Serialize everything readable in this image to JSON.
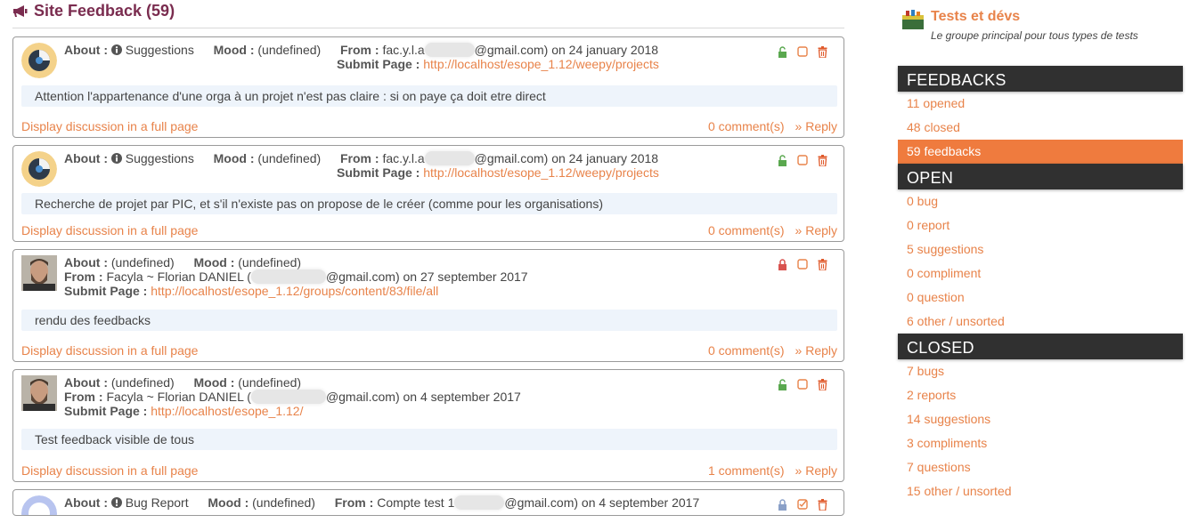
{
  "header": {
    "title": "Site Feedback (59)"
  },
  "labels": {
    "about": "About :",
    "mood": "Mood :",
    "from": "From :",
    "submit_page": "Submit Page :",
    "display_full": "Display discussion in a full page",
    "reply": "» Reply"
  },
  "feedbacks": [
    {
      "about": "Suggestions",
      "mood": "(undefined)",
      "from_prefix": "fac.y.l.a",
      "from_suffix": "@gmail.com) on 24 january 2018",
      "submit_page": "http://localhost/esope_1.12/weepy/projects",
      "message": "Attention l'appartenance d'une orga à un projet n'est pas claire : si on paye ça doit etre direct",
      "comments": "0 comment(s)"
    },
    {
      "about": "Suggestions",
      "mood": "(undefined)",
      "from_prefix": "fac.y.l.a",
      "from_suffix": "@gmail.com) on 24 january 2018",
      "submit_page": "http://localhost/esope_1.12/weepy/projects",
      "message": "Recherche de projet par PIC, et s'il n'existe pas on propose de le créer (comme pour les organisations)",
      "comments": "0 comment(s)"
    },
    {
      "about": "(undefined)",
      "mood": "(undefined)",
      "from_prefix": "Facyla ~ Florian DANIEL (",
      "from_suffix": "@gmail.com) on 27 september 2017",
      "submit_page": "http://localhost/esope_1.12/groups/content/83/file/all",
      "message": "rendu des feedbacks",
      "comments": "0 comment(s)"
    },
    {
      "about": "(undefined)",
      "mood": "(undefined)",
      "from_prefix": "Facyla ~ Florian DANIEL (",
      "from_suffix": "@gmail.com) on 4 september 2017",
      "submit_page": "http://localhost/esope_1.12/",
      "message": "Test feedback visible de tous",
      "comments": "1 comment(s)"
    },
    {
      "about": "Bug Report",
      "mood": "(undefined)",
      "from_prefix": "Compte test 1",
      "from_suffix": "@gmail.com) on 4 september 2017"
    }
  ],
  "sidebar": {
    "group_name": "Tests et dévs",
    "group_desc": "Le groupe principal pour tous types de tests",
    "sections": {
      "feedbacks": "FEEDBACKS",
      "open": "OPEN",
      "closed": "CLOSED"
    },
    "feedbacks": [
      "11 opened",
      "48 closed",
      "59 feedbacks"
    ],
    "open": [
      "0 bug",
      "0 report",
      "5 suggestions",
      "0 compliment",
      "0 question",
      "6 other / unsorted"
    ],
    "closed": [
      "7 bugs",
      "2 reports",
      "14 suggestions",
      "3 compliments",
      "7 questions",
      "15 other / unsorted"
    ]
  },
  "colors": {
    "accent": "#e8834a",
    "active": "#ef7b3e",
    "section_bg": "#303030",
    "title": "#7a2c4f",
    "lock_open": "#5aa84f",
    "lock_closed": "#d9534f"
  }
}
